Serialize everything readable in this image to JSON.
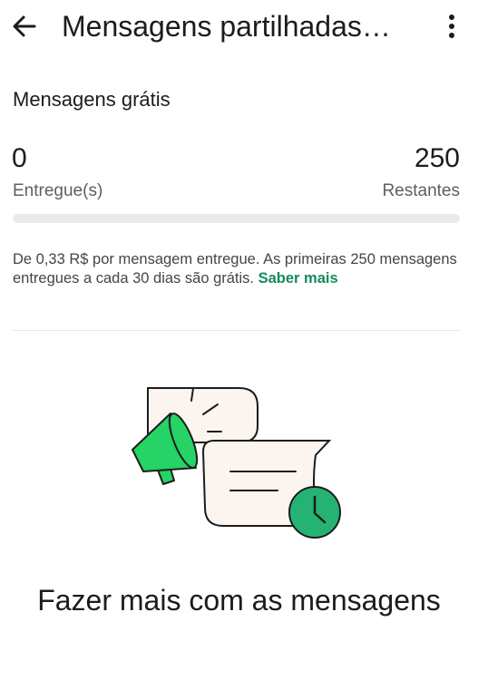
{
  "header": {
    "title": "Mensagens partilhadas",
    "back_icon": "arrow-left-icon",
    "more_icon": "more-vertical-icon"
  },
  "free_messages": {
    "title": "Mensagens grátis",
    "delivered_value": "0",
    "delivered_label": "Entregue(s)",
    "remaining_value": "250",
    "remaining_label": "Restantes",
    "progress_fraction": 0,
    "info_text": "De 0,33 R$ por mensagem entregue. As primeiras 250 mensagens entregues a cada 30 dias são grátis. ",
    "learn_more_label": "Saber mais"
  },
  "promo": {
    "illustration_icon": "megaphone-chat-clock-icon",
    "title": "Fazer mais com as mensagens"
  },
  "colors": {
    "accent": "#168a5c",
    "progress_track": "#e8eaeb",
    "illustration_green": "#25d366",
    "bubble_fill": "#fcf5ef"
  }
}
